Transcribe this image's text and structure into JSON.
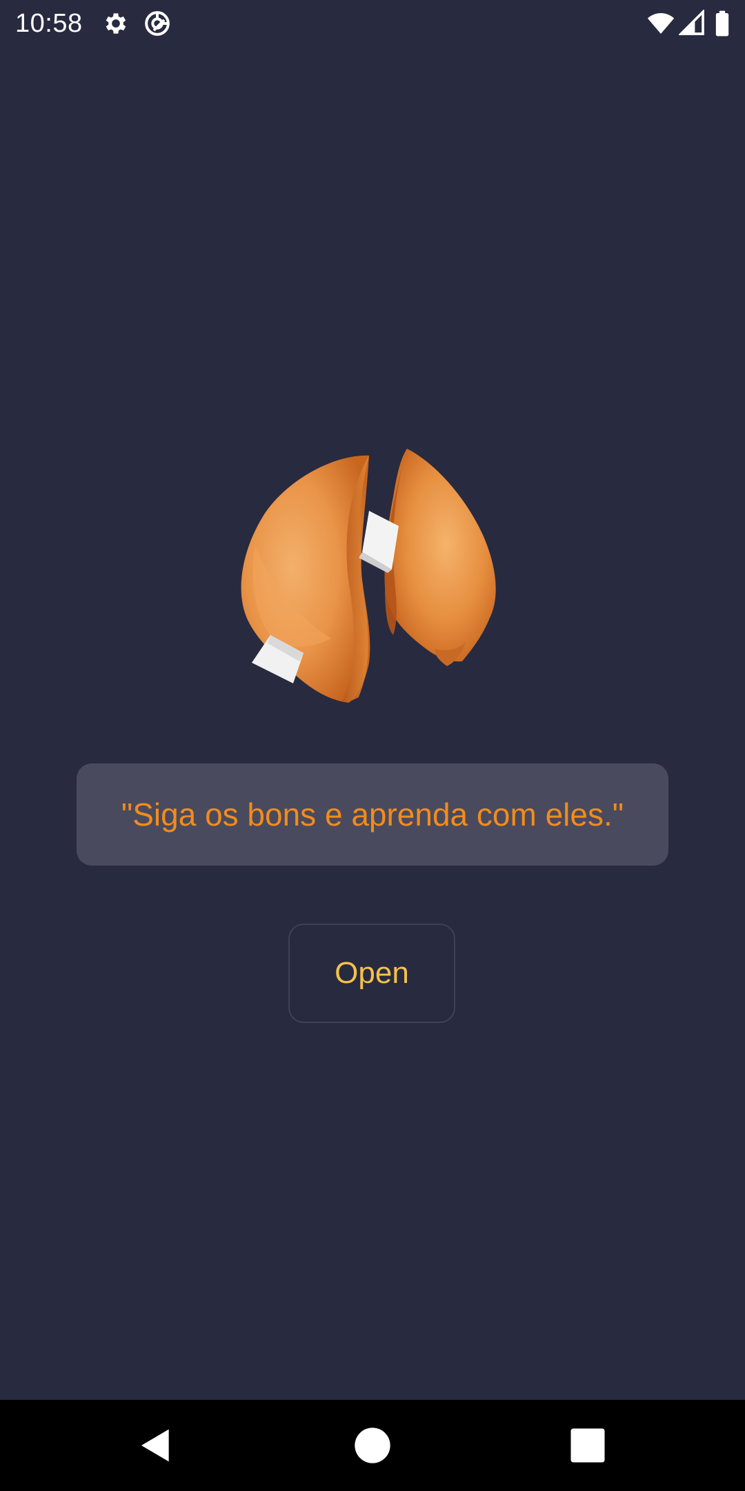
{
  "status_bar": {
    "time": "10:58",
    "icons": [
      "gear-icon",
      "at-sign-icon",
      "wifi-icon",
      "cellular-signal-icon",
      "battery-icon"
    ]
  },
  "cookie_image": {
    "name": "fortune-cookie-broken-image"
  },
  "fortune": {
    "text": "\"Siga os bons e aprenda com eles.\""
  },
  "actions": {
    "open_label": "Open"
  },
  "nav_bar": {
    "icons": [
      "back-icon",
      "home-icon",
      "recents-icon"
    ]
  },
  "colors": {
    "background": "#282a3f",
    "card": "#4a4a5e",
    "fortune_text": "#f28c1c",
    "button_text": "#f4c14a",
    "button_border": "#3e4258",
    "nav_bar": "#000000"
  }
}
